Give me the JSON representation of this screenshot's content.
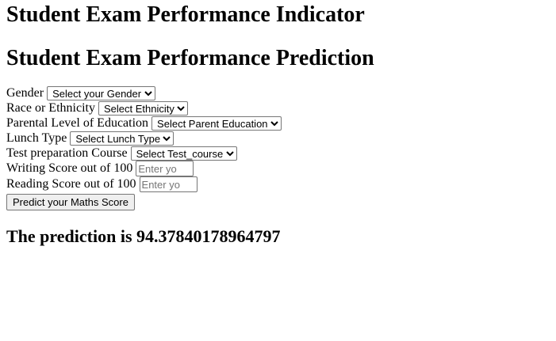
{
  "page": {
    "title": "Student Exam Performance Indicator",
    "subtitle": "Student Exam Performance Prediction"
  },
  "form": {
    "gender": {
      "label": "Gender",
      "selected": "Select your Gender"
    },
    "ethnicity": {
      "label": "Race or Ethnicity",
      "selected": "Select Ethnicity"
    },
    "parental_education": {
      "label": "Parental Level of Education",
      "selected": "Select Parent Education"
    },
    "lunch": {
      "label": "Lunch Type",
      "selected": "Select Lunch Type"
    },
    "test_prep": {
      "label": "Test preparation Course",
      "selected": "Select Test_course"
    },
    "writing_score": {
      "label": "Writing Score out of 100",
      "placeholder": "Enter yo"
    },
    "reading_score": {
      "label": "Reading Score out of 100",
      "placeholder": "Enter yo"
    },
    "submit_label": "Predict your Maths Score"
  },
  "result": {
    "text": "The prediction is 94.37840178964797"
  }
}
